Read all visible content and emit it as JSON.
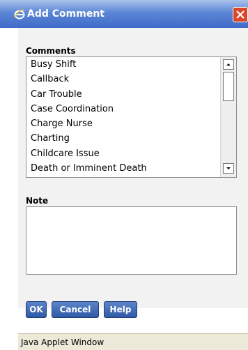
{
  "window": {
    "title": "Add Comment",
    "icon": "internet-explorer-icon",
    "close_icon": "close-icon"
  },
  "form": {
    "comments_label": "Comments",
    "comments": [
      "Busy Shift",
      "Callback",
      "Car Trouble",
      "Case Coordination",
      "Charge Nurse",
      "Charting",
      "Childcare Issue",
      "Death or Imminent Death"
    ],
    "note_label": "Note",
    "note_value": ""
  },
  "buttons": {
    "ok": "OK",
    "cancel": "Cancel",
    "help": "Help"
  },
  "status": {
    "text": "Java Applet Window"
  },
  "colors": {
    "titlebar": "#3f6bc8",
    "button": "#2f5aa6",
    "close_button": "#d9462a",
    "dialog_background": "#f2f2f2"
  }
}
